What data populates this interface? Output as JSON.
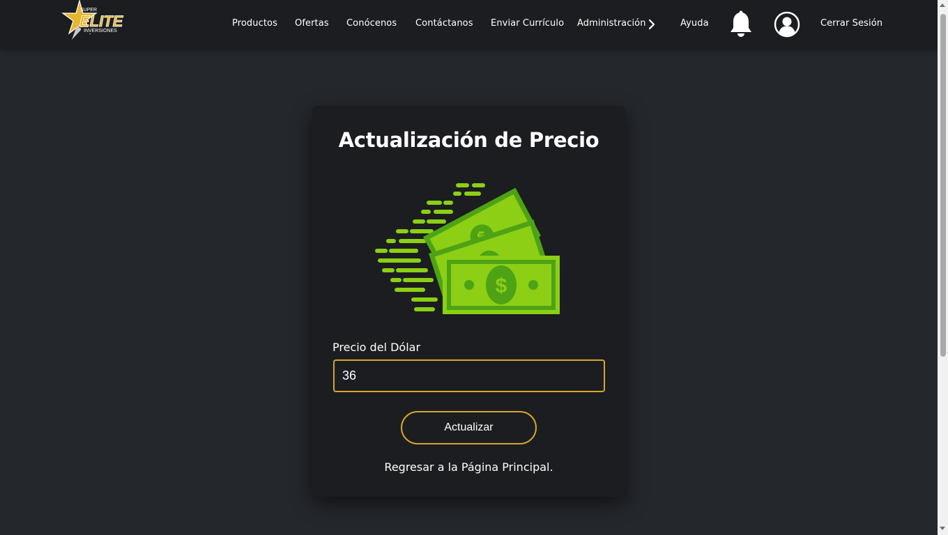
{
  "brand": {
    "logo_top": "SUPER",
    "logo_main": "ELITE",
    "logo_sub": "INVERSIONES"
  },
  "nav": {
    "items": [
      "Productos",
      "Ofertas",
      "Conócenos",
      "Contáctanos",
      "Enviar Currículo",
      "Administración",
      "Ayuda"
    ],
    "logout": "Cerrar Sesión"
  },
  "card": {
    "title": "Actualización de Precio",
    "field_label": "Precio del Dólar",
    "field_value": "36",
    "button_label": "Actualizar",
    "back_link": "Regresar a la Página Principal."
  },
  "colors": {
    "background": "#24272c",
    "navbar": "#1c1d20",
    "card": "#1c1d20",
    "accent": "#d4a82a",
    "money_light": "#8ccf14",
    "money_dark": "#4ea315"
  },
  "icons": [
    "star-logo-icon",
    "chevron-right-icon",
    "bell-icon",
    "user-circle-icon",
    "money-bills-icon"
  ]
}
